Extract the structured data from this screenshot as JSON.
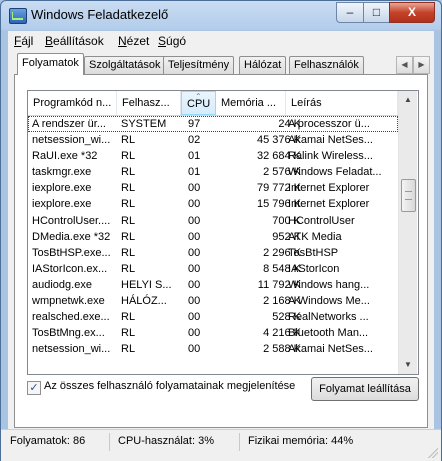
{
  "window": {
    "title": "Windows Feladatkezelő"
  },
  "titlebar_buttons": {
    "minimize": "–",
    "maximize": "□",
    "close": "X"
  },
  "menu": [
    {
      "label": "Fájl",
      "accel": "F",
      "rest": "ájl"
    },
    {
      "label": "Beállítások",
      "accel": "B",
      "rest": "eállítások"
    },
    {
      "label": "Nézet",
      "accel": "N",
      "rest": "ézet"
    },
    {
      "label": "Súgó",
      "accel": "S",
      "rest": "úgó"
    }
  ],
  "tabs": [
    {
      "label": "Folyamatok",
      "active": true
    },
    {
      "label": "Szolgáltatások",
      "active": false
    },
    {
      "label": "Teljesítmény",
      "active": false
    },
    {
      "label": "Hálózat",
      "active": false
    },
    {
      "label": "Felhasználók",
      "active": false
    }
  ],
  "tab_scroll": {
    "left": "◀",
    "right": "▶"
  },
  "columns": [
    "Programkód n...",
    "Felhasz...",
    "CPU",
    "Memória ...",
    "Leírás"
  ],
  "sorted_column": "CPU",
  "processes": [
    {
      "name": "A rendszer ür...",
      "user": "SYSTEM",
      "cpu": "97",
      "memory": "24 K",
      "description": "A processzor ü..."
    },
    {
      "name": "netsession_wi...",
      "user": "RL",
      "cpu": "02",
      "memory": "45 376 K",
      "description": "Akamai NetSes..."
    },
    {
      "name": "RaUI.exe *32",
      "user": "RL",
      "cpu": "01",
      "memory": "32 684 K",
      "description": "Ralink Wireless..."
    },
    {
      "name": "taskmgr.exe",
      "user": "RL",
      "cpu": "01",
      "memory": "2 576 K",
      "description": "Windows Feladat..."
    },
    {
      "name": "iexplore.exe",
      "user": "RL",
      "cpu": "00",
      "memory": "79 772 K",
      "description": "Internet Explorer"
    },
    {
      "name": "iexplore.exe",
      "user": "RL",
      "cpu": "00",
      "memory": "15 796 K",
      "description": "Internet Explorer"
    },
    {
      "name": "HControlUser....",
      "user": "RL",
      "cpu": "00",
      "memory": "700 K",
      "description": "HControlUser"
    },
    {
      "name": "DMedia.exe *32",
      "user": "RL",
      "cpu": "00",
      "memory": "952 K",
      "description": "ATK Media"
    },
    {
      "name": "TosBtHSP.exe...",
      "user": "RL",
      "cpu": "00",
      "memory": "2 296 K",
      "description": "TosBtHSP"
    },
    {
      "name": "IAStorIcon.ex...",
      "user": "RL",
      "cpu": "00",
      "memory": "8 548 K",
      "description": "IAStorIcon"
    },
    {
      "name": "audiodg.exe",
      "user": "HELYI S...",
      "cpu": "00",
      "memory": "11 792 K",
      "description": "Windows hang..."
    },
    {
      "name": "wmpnetwk.exe",
      "user": "HÁLÓZ...",
      "cpu": "00",
      "memory": "2 168 K",
      "description": "A Windows Me..."
    },
    {
      "name": "realsched.exe...",
      "user": "RL",
      "cpu": "00",
      "memory": "528 K",
      "description": "RealNetworks ..."
    },
    {
      "name": "TosBtMng.ex...",
      "user": "RL",
      "cpu": "00",
      "memory": "4 216 K",
      "description": "Bluetooth Man..."
    },
    {
      "name": "netsession_wi...",
      "user": "RL",
      "cpu": "00",
      "memory": "2 588 K",
      "description": "Akamai NetSes..."
    }
  ],
  "scrollbar": {
    "up": "▲",
    "down": "▼"
  },
  "show_all_checkbox": {
    "checked": true,
    "mark": "✓",
    "label": "Az összes felhasználó folyamatainak megjelenítése"
  },
  "end_process_button": "Folyamat leállítása",
  "status": {
    "processes": "Folyamatok: 86",
    "cpu": "CPU-használat: 3%",
    "memory": "Fizikai memória: 44%"
  }
}
